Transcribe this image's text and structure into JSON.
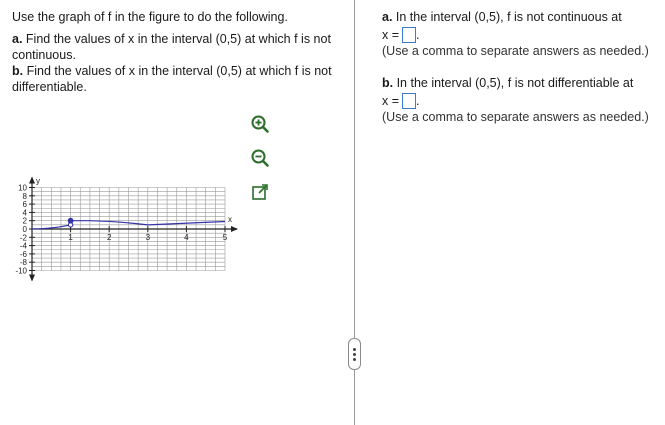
{
  "question": {
    "intro": "Use the graph of f in the figure to do the following.",
    "part_a_label": "a.",
    "part_a_text": " Find the values of x in the interval (0,5) at which f is not continuous.",
    "part_b_label": "b.",
    "part_b_text": " Find the values of x in the interval (0,5) at which f is not differentiable."
  },
  "graph": {
    "x_axis_label": "x",
    "y_axis_label": "y",
    "x_tick_labels": [
      "1",
      "2",
      "3",
      "4",
      "5"
    ],
    "y_tick_labels": [
      "10",
      "8",
      "6",
      "4",
      "2",
      "0",
      "-2",
      "-4",
      "-6",
      "-8",
      "-10"
    ],
    "line_color": "#3333aa"
  },
  "tools": {
    "zoom_in": "zoom-in-icon",
    "zoom_out": "zoom-out-icon",
    "popout": "popout-icon",
    "icon_color": "#2a6e2a"
  },
  "answers": {
    "a_label": "a.",
    "a_text": " In the interval (0,5), f is not continuous at",
    "a_var": "x =",
    "a_value": "",
    "a_hint": "(Use a comma to separate answers as needed.)",
    "b_label": "b.",
    "b_text": " In the interval (0,5), f is not differentiable at",
    "b_var": "x =",
    "b_value": "",
    "b_hint": "(Use a comma to separate answers as needed.)"
  }
}
